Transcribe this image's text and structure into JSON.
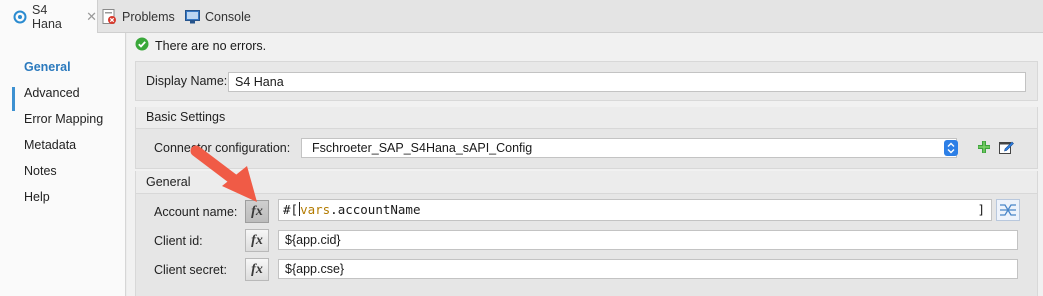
{
  "tabs": [
    {
      "label": "S4 Hana",
      "icon": "connector-icon",
      "active": true
    },
    {
      "label": "Problems",
      "icon": "problems-icon",
      "active": false
    },
    {
      "label": "Console",
      "icon": "console-icon",
      "active": false
    }
  ],
  "nav": {
    "items": [
      "General",
      "Advanced",
      "Error Mapping",
      "Metadata",
      "Notes",
      "Help"
    ],
    "selected": "General"
  },
  "status": {
    "text": "There are no errors.",
    "icon": "check-circle-icon",
    "color": "#3aa83a"
  },
  "display_name": {
    "label": "Display Name:",
    "value": "S4 Hana"
  },
  "basic_settings": {
    "title": "Basic Settings",
    "connector_label": "Connector configuration:",
    "connector_value": "Fschroeter_SAP_S4Hana_sAPI_Config",
    "add_icon": "plus-icon",
    "edit_icon": "edit-icon"
  },
  "general": {
    "title": "General",
    "account_label": "Account name:",
    "account_expr_prefix": "#[",
    "account_expr_kw": "vars",
    "account_expr_rest": ".accountName",
    "account_expr_suffix": "]",
    "client_id_label": "Client id:",
    "client_id_value": "${app.cid}",
    "client_secret_label": "Client secret:",
    "client_secret_value": "${app.cse}",
    "fx_label": "fx",
    "mapping_icon": "data-mapping-icon"
  },
  "colors": {
    "accent": "#3d91d1",
    "arrow": "#f05b46",
    "select": "#2d7fe6",
    "keyword": "#b37b00"
  }
}
